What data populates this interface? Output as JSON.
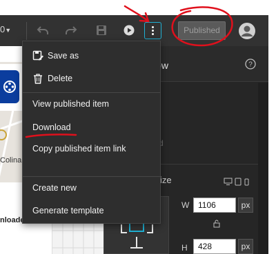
{
  "toolbar": {
    "zoom_value": "0",
    "published_label": "Published"
  },
  "menu": {
    "items": [
      {
        "label": "Save as",
        "icon": "save-as-icon"
      },
      {
        "label": "Delete",
        "icon": "trash-icon"
      },
      {
        "label": "View published item"
      },
      {
        "label": "Download"
      },
      {
        "label": "Copy published item link"
      },
      {
        "label": "Create new"
      },
      {
        "label": "Generate template"
      }
    ]
  },
  "panel": {
    "title_fragment": "low",
    "faint_fragment": "d",
    "size_fragment": "ize",
    "width_label": "W",
    "width_value": "1106",
    "height_label": "H",
    "height_value": "428",
    "unit": "px"
  },
  "canvas": {
    "map_fragment": "Colina",
    "download_fragment": "nloade"
  },
  "colors": {
    "toolbar_bg": "#323232",
    "menu_bg": "#2e2e2e",
    "accent": "#1fb2d6",
    "annotation": "#e0101c"
  }
}
